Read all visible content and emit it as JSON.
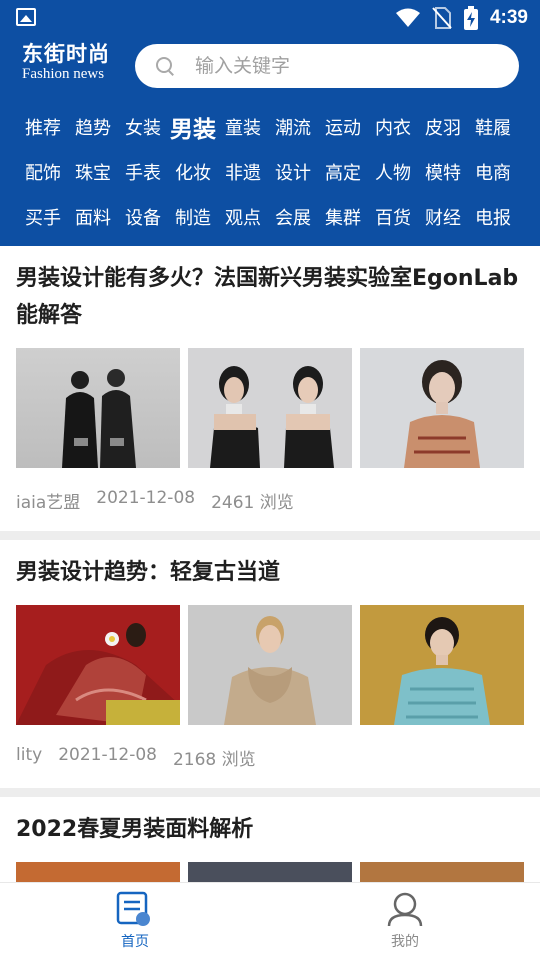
{
  "status_bar": {
    "time": "4:39"
  },
  "header": {
    "logo_cn": "东街时尚",
    "logo_en": "Fashion news",
    "search_placeholder": "输入关键字"
  },
  "categories": [
    "推荐",
    "趋势",
    "女装",
    "男装",
    "童装",
    "潮流",
    "运动",
    "内衣",
    "皮羽",
    "鞋履",
    "配饰",
    "珠宝",
    "手表",
    "化妆",
    "非遗",
    "设计",
    "高定",
    "人物",
    "模特",
    "电商",
    "买手",
    "面料",
    "设备",
    "制造",
    "观点",
    "会展",
    "集群",
    "百货",
    "财经",
    "电报"
  ],
  "active_category": "男装",
  "articles": [
    {
      "title": "男装设计能有多火？法国新兴男装实验室EgonLab能解答",
      "source": "iaia艺盟",
      "date": "2021-12-08",
      "views": "2461 浏览"
    },
    {
      "title": "男装设计趋势：轻复古当道",
      "source": "lity",
      "date": "2021-12-08",
      "views": "2168 浏览"
    },
    {
      "title": "2022春夏男装面料解析"
    }
  ],
  "bottom_nav": {
    "home_label": "首页",
    "mine_label": "我的"
  },
  "colors": {
    "header_bg": "#0d4fa3",
    "nav_active": "#1565c0",
    "nav_inactive": "#8a8a8a"
  }
}
